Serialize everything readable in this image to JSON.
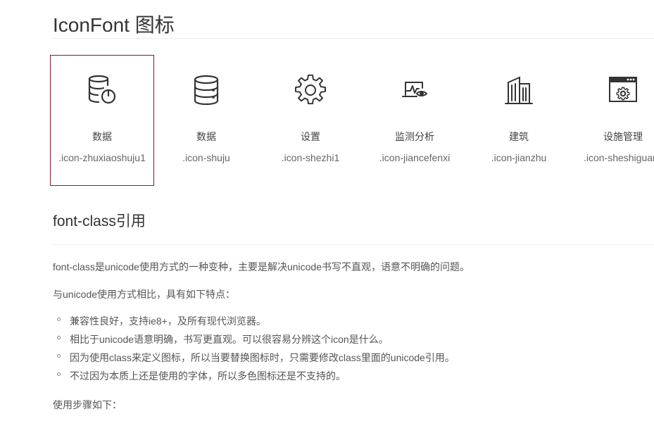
{
  "page": {
    "title": "IconFont 图标",
    "section_title": "font-class引用"
  },
  "icons": [
    {
      "name": "数据",
      "code": ".icon-zhuxiaoshuju1",
      "glyph": "database-power-icon",
      "selected": true
    },
    {
      "name": "数据",
      "code": ".icon-shuju",
      "glyph": "database-icon",
      "selected": false
    },
    {
      "name": "设置",
      "code": ".icon-shezhi1",
      "glyph": "gear-icon",
      "selected": false
    },
    {
      "name": "监测分析",
      "code": ".icon-jiancefenxi",
      "glyph": "monitor-eye-icon",
      "selected": false
    },
    {
      "name": "建筑",
      "code": ".icon-jianzhu",
      "glyph": "building-icon",
      "selected": false
    },
    {
      "name": "设施管理",
      "code": ".icon-sheshiguanli",
      "glyph": "window-gear-icon",
      "selected": false
    }
  ],
  "content": {
    "intro": "font-class是unicode使用方式的一种变种，主要是解决unicode书写不直观，语意不明确的问题。",
    "compare": "与unicode使用方式相比，具有如下特点：",
    "features": [
      "兼容性良好，支持ie8+，及所有现代浏览器。",
      "相比于unicode语意明确，书写更直观。可以很容易分辨这个icon是什么。",
      "因为使用class来定义图标，所以当要替换图标时，只需要修改class里面的unicode引用。",
      "不过因为本质上还是使用的字体，所以多色图标还是不支持的。"
    ],
    "steps": "使用步骤如下："
  },
  "colors": {
    "selected_border": "#8b1a2a",
    "icon_stroke": "#333333",
    "rule": "#eeeeee"
  }
}
